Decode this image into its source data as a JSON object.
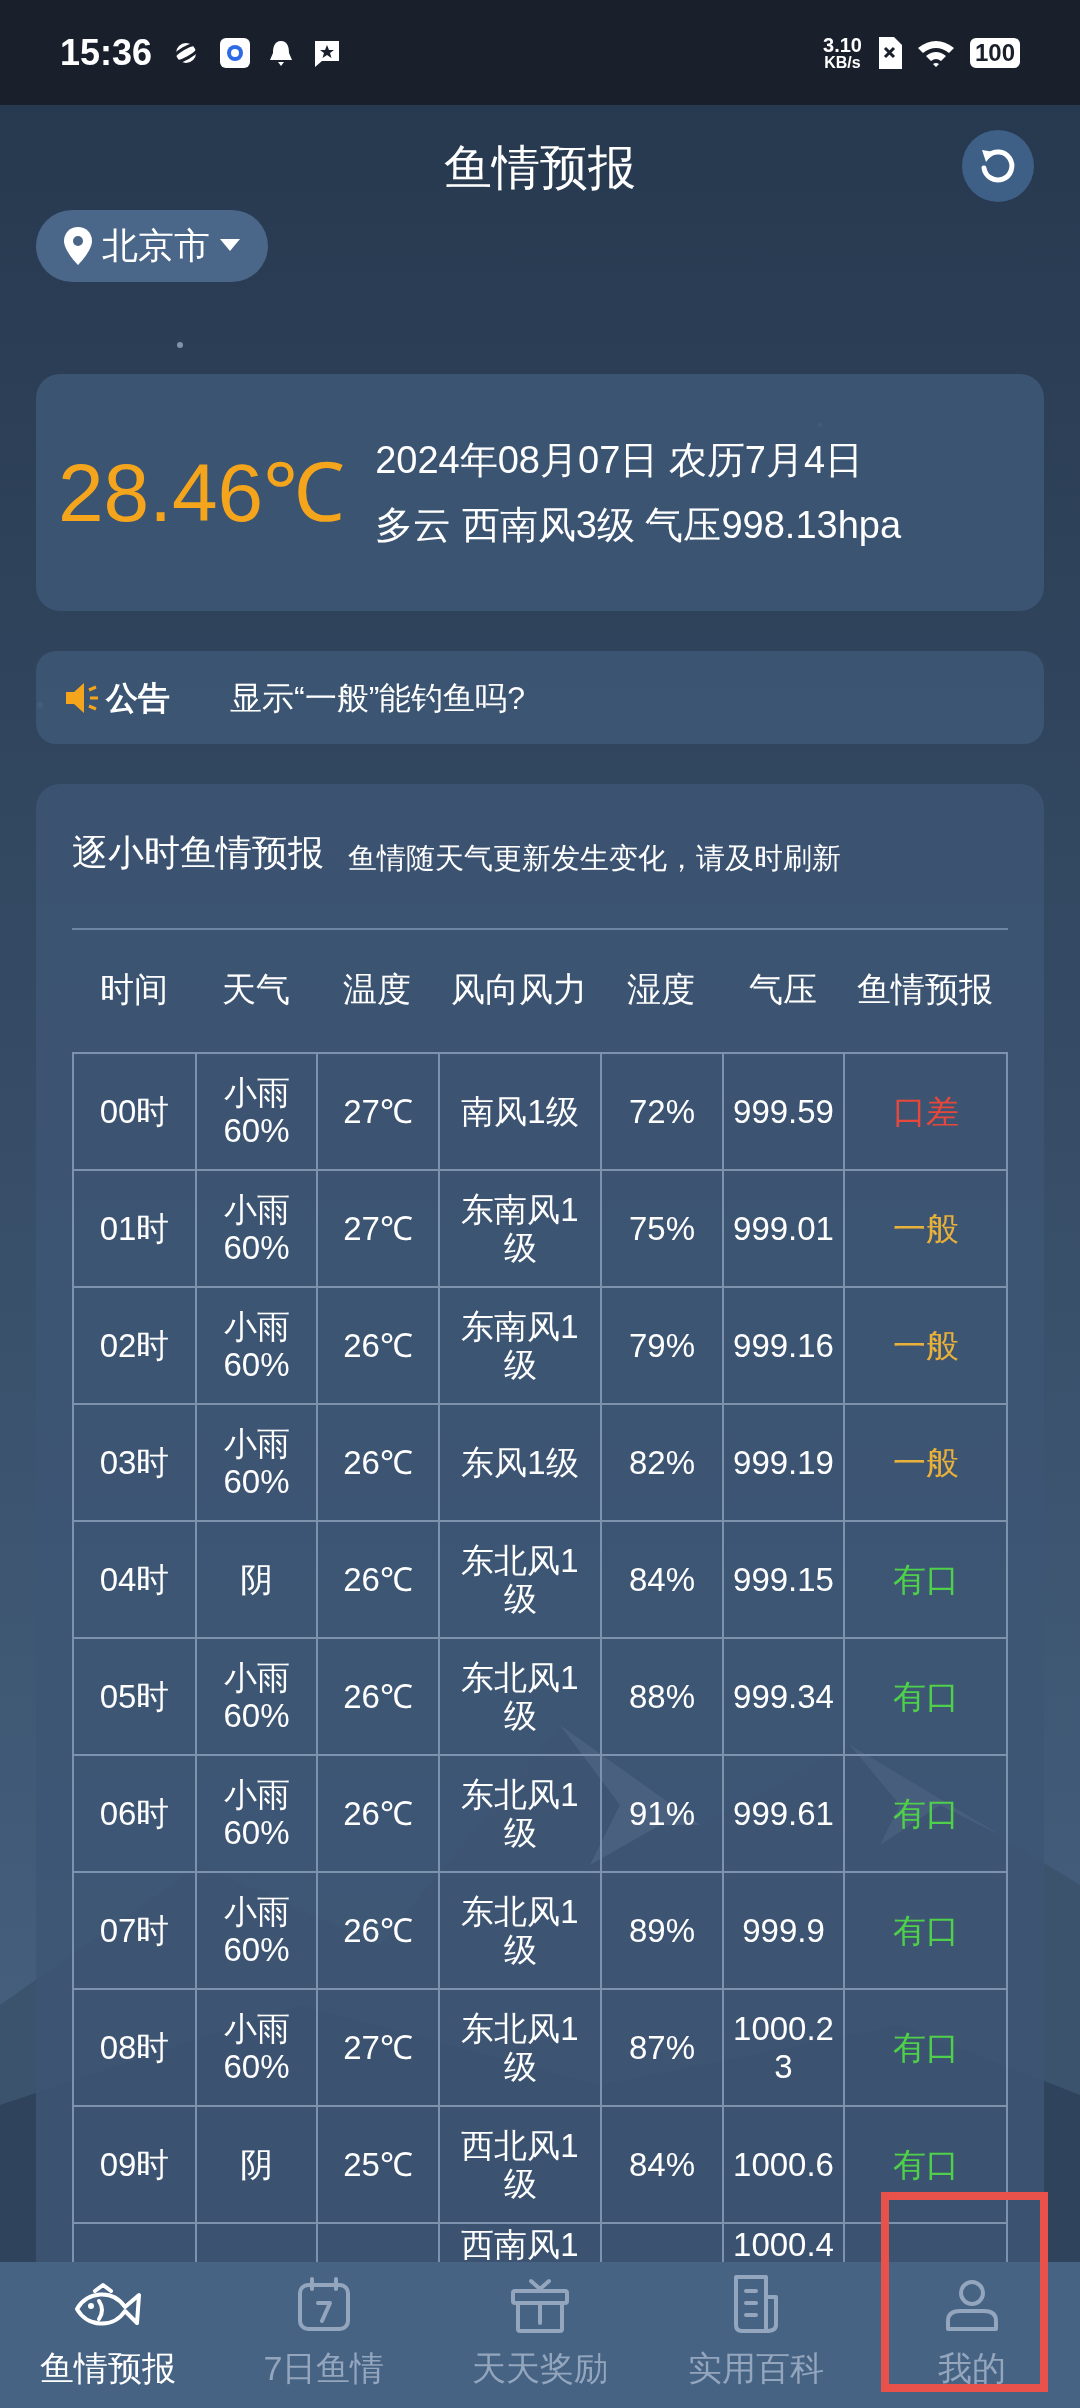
{
  "status_bar": {
    "time": "15:36",
    "speed_value": "3.10",
    "speed_unit": "KB/s",
    "battery": "100"
  },
  "header": {
    "title": "鱼情预报",
    "location": "北京市"
  },
  "weather": {
    "temperature": "28.46℃",
    "date_line": "2024年08月07日 农历7月4日",
    "detail_line": "多云 西南风3级 气压998.13hpa"
  },
  "notice": {
    "label": "公告",
    "text": "显示“一般”能钓鱼吗?"
  },
  "forecast": {
    "title": "逐小时鱼情预报",
    "subtitle": "鱼情随天气更新发生变化，请及时刷新",
    "columns": [
      "时间",
      "天气",
      "温度",
      "风向风力",
      "湿度",
      "气压",
      "鱼情预报"
    ],
    "rows": [
      {
        "cells": [
          "00时",
          "小雨60%",
          "27℃",
          "南风1级",
          "72%",
          "999.59",
          "口差"
        ],
        "kind": "poor"
      },
      {
        "cells": [
          "01时",
          "小雨60%",
          "27℃",
          "东南风1级",
          "75%",
          "999.01",
          "一般"
        ],
        "kind": "fair"
      },
      {
        "cells": [
          "02时",
          "小雨60%",
          "26℃",
          "东南风1级",
          "79%",
          "999.16",
          "一般"
        ],
        "kind": "fair"
      },
      {
        "cells": [
          "03时",
          "小雨60%",
          "26℃",
          "东风1级",
          "82%",
          "999.19",
          "一般"
        ],
        "kind": "fair"
      },
      {
        "cells": [
          "04时",
          "阴",
          "26℃",
          "东北风1级",
          "84%",
          "999.15",
          "有口"
        ],
        "kind": "good"
      },
      {
        "cells": [
          "05时",
          "小雨60%",
          "26℃",
          "东北风1级",
          "88%",
          "999.34",
          "有口"
        ],
        "kind": "good"
      },
      {
        "cells": [
          "06时",
          "小雨60%",
          "26℃",
          "东北风1级",
          "91%",
          "999.61",
          "有口"
        ],
        "kind": "good"
      },
      {
        "cells": [
          "07时",
          "小雨60%",
          "26℃",
          "东北风1级",
          "89%",
          "999.9",
          "有口"
        ],
        "kind": "good"
      },
      {
        "cells": [
          "08时",
          "小雨60%",
          "27℃",
          "东北风1级",
          "87%",
          "1000.23",
          "有口"
        ],
        "kind": "good"
      },
      {
        "cells": [
          "09时",
          "阴",
          "25℃",
          "西北风1级",
          "84%",
          "1000.6",
          "有口"
        ],
        "kind": "good"
      },
      {
        "cells": [
          "",
          "",
          "",
          "西南风1",
          "",
          "1000.4",
          ""
        ]
      }
    ]
  },
  "nav": [
    {
      "label": "鱼情预报",
      "kind": "fish",
      "selected": true,
      "highlight": false
    },
    {
      "label": "7日鱼情",
      "kind": "calendar",
      "selected": false,
      "highlight": false
    },
    {
      "label": "天天奖励",
      "kind": "gift",
      "selected": false,
      "highlight": false
    },
    {
      "label": "实用百科",
      "kind": "doc",
      "selected": false,
      "highlight": false
    },
    {
      "label": "我的",
      "kind": "user",
      "selected": false,
      "highlight": true
    }
  ]
}
